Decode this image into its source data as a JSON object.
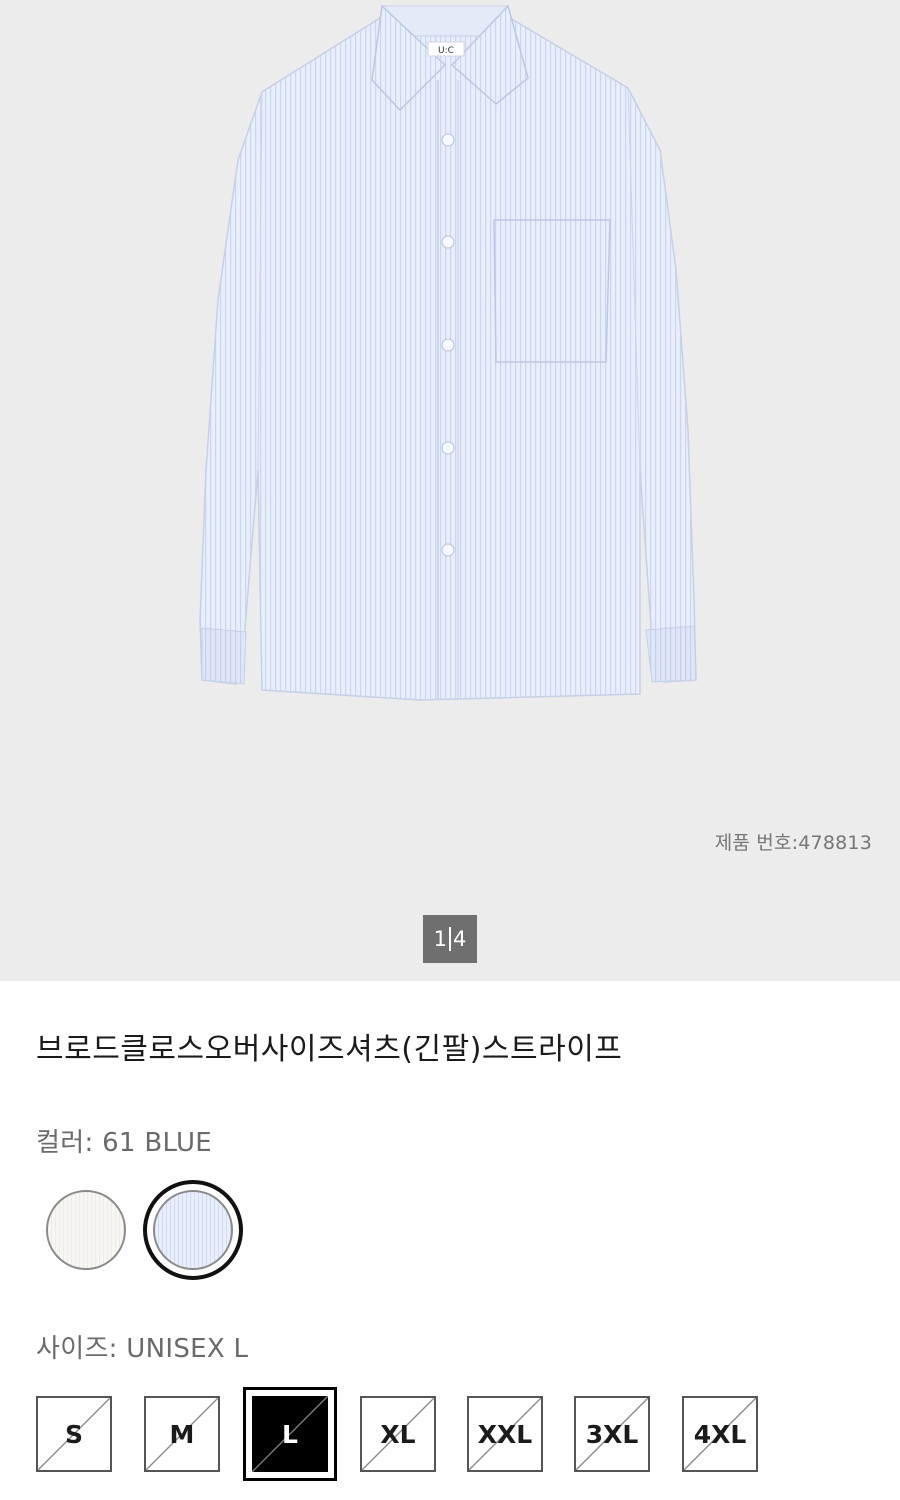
{
  "gallery": {
    "product_number": "제품 번호:478813",
    "pager_current": "1",
    "pager_total": "4",
    "brand_tag": "U:C"
  },
  "product": {
    "name": "브로드클로스오버사이즈셔츠(긴팔)스트라이프"
  },
  "color": {
    "label": "컬러: 61 BLUE",
    "swatches": [
      {
        "name": "white",
        "color": "#f3f2ee",
        "selected": false
      },
      {
        "name": "blue",
        "color": "#dde6f8",
        "selected": true
      }
    ]
  },
  "size": {
    "label": "사이즈: UNISEX L",
    "options": [
      {
        "label": "S",
        "selected": false,
        "available": false
      },
      {
        "label": "M",
        "selected": false,
        "available": false
      },
      {
        "label": "L",
        "selected": true,
        "available": false
      },
      {
        "label": "XL",
        "selected": false,
        "available": false
      },
      {
        "label": "XXL",
        "selected": false,
        "available": false
      },
      {
        "label": "3XL",
        "selected": false,
        "available": false
      },
      {
        "label": "4XL",
        "selected": false,
        "available": false
      }
    ]
  }
}
